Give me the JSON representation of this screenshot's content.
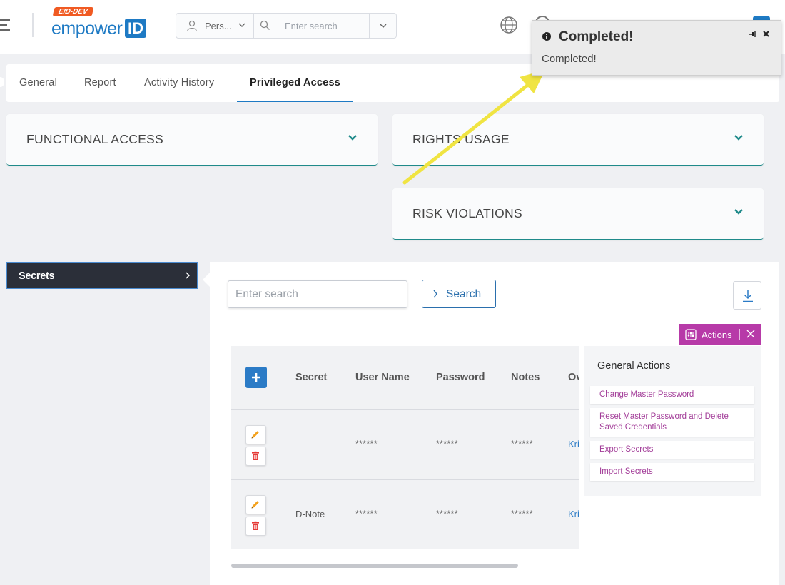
{
  "header": {
    "env_badge": "EID-DEV",
    "logo_text": "empower",
    "logo_id": "ID",
    "search_scope": "Pers...",
    "search_placeholder": "Enter search"
  },
  "tabs": [
    {
      "label": "General"
    },
    {
      "label": "Report"
    },
    {
      "label": "Activity History"
    },
    {
      "label": "Privileged Access",
      "active": true
    }
  ],
  "accordions": {
    "functional_access": "FUNCTIONAL ACCESS",
    "rights_usage": "RIGHTS USAGE",
    "risk_violations": "RISK VIOLATIONS"
  },
  "left_nav": {
    "item": "Secrets"
  },
  "secrets": {
    "search_placeholder": "Enter search",
    "search_button": "Search",
    "actions_label": "Actions",
    "columns": [
      "Secret",
      "User Name",
      "Password",
      "Notes",
      "Ov"
    ],
    "rows": [
      {
        "secret": "",
        "user_name": "******",
        "password": "******",
        "notes": "******",
        "owner": "Kri"
      },
      {
        "secret": "D-Note",
        "user_name": "******",
        "password": "******",
        "notes": "******",
        "owner": "Kri"
      }
    ]
  },
  "general_actions": {
    "title": "General Actions",
    "items": [
      "Change Master Password",
      "Reset Master Password and Delete Saved Credentials",
      "Export Secrets",
      "Import Secrets"
    ]
  },
  "toast": {
    "title": "Completed!",
    "message": "Completed!"
  },
  "colors": {
    "brand_blue": "#1e7ac4",
    "accent_teal": "#1f8a8a",
    "actions_magenta": "#b73aa8",
    "annotation_arrow": "#f0e442",
    "env_badge": "#f05a22"
  }
}
